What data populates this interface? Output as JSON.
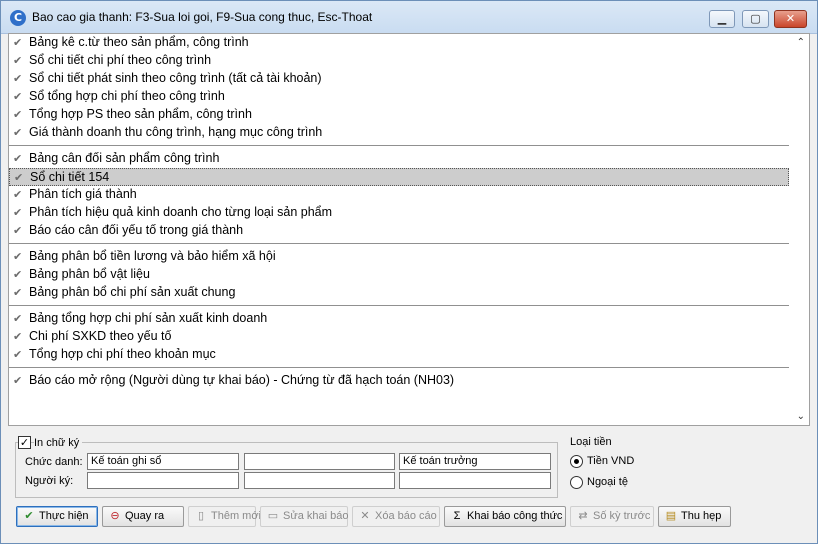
{
  "window": {
    "title": "Bao cao gia thanh: F3-Sua loi goi, F9-Sua cong thuc, Esc-Thoat"
  },
  "list": {
    "items": [
      "Bảng kê c.từ theo sản phẩm, công trình",
      "Sổ chi tiết chi phí theo công trình",
      "Sổ chi tiết phát sinh theo công trình (tất cả tài khoản)",
      "Sổ tổng hợp chi phí theo công trình",
      "Tổng hợp PS theo sản phẩm, công trình",
      "Giá thành doanh thu công trình, hạng mục công trình",
      "Bảng cân đối sản phẩm công trình",
      "Sổ chi tiết 154",
      "Phân tích giá thành",
      "Phân tích hiệu quả kinh doanh cho từng loại sản phẩm",
      "Báo cáo cân đối yếu tố trong giá thành",
      "Bảng phân bổ tiền lương và bảo hiểm xã hội",
      "Bảng phân bổ vật liệu",
      "Bảng phân bổ chi phí sản xuất chung",
      "Bảng tổng hợp chi phí sản xuất kinh doanh",
      "Chi phí SXKD theo yếu tố",
      "Tổng hợp chi phí theo khoản mục",
      "Báo cáo mở rộng (Người dùng tự khai báo) - Chứng từ đã hạch toán (NH03)"
    ]
  },
  "signature": {
    "checkbox_label": "In chữ ký",
    "title_label": "Chức danh:",
    "signer_label": "Người ký:",
    "title_values": [
      "Kế toán ghi sổ",
      "",
      "Kế toán trưởng"
    ],
    "signer_values": [
      "",
      "",
      ""
    ]
  },
  "currency": {
    "label": "Loại tiền",
    "options": [
      "Tiền VND",
      "Ngoại tệ"
    ]
  },
  "buttons": {
    "execute": "Thực hiện",
    "back": "Quay ra",
    "add": "Thêm mới",
    "edit": "Sửa khai báo",
    "delete": "Xóa báo cáo",
    "declare_formula": "Khai báo công thức",
    "prev_period": "Số kỳ trước",
    "collapse": "Thu hẹp"
  }
}
